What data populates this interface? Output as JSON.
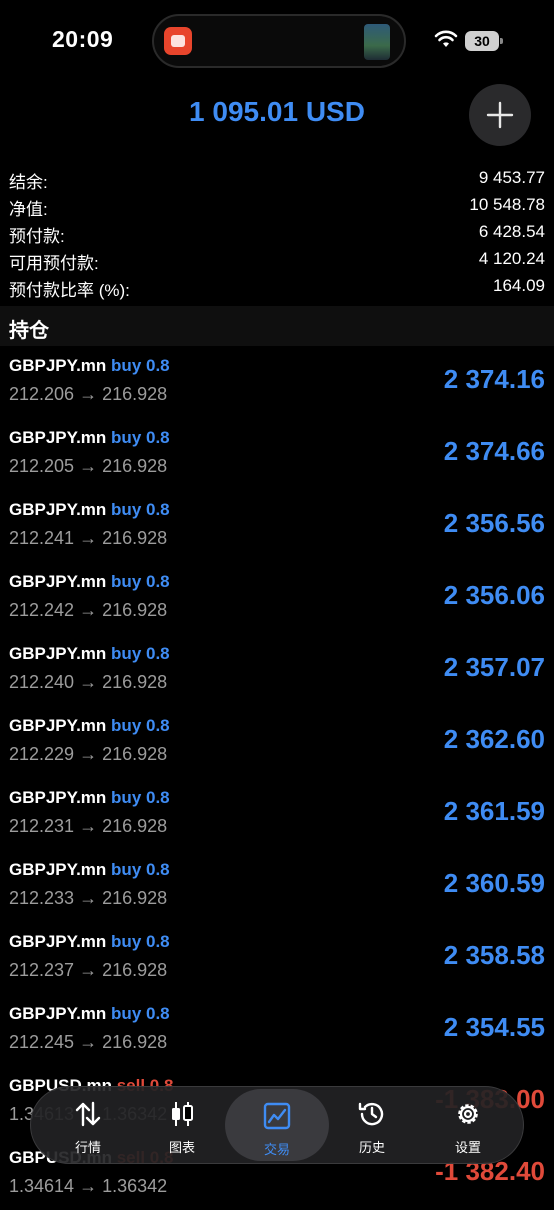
{
  "status_bar": {
    "time": "20:09",
    "battery": "30"
  },
  "header": {
    "balance": "1 095.01 USD"
  },
  "summary": [
    {
      "label": "结余:",
      "value": "9 453.77"
    },
    {
      "label": "净值:",
      "value": "10 548.78"
    },
    {
      "label": "预付款:",
      "value": "6 428.54"
    },
    {
      "label": "可用预付款:",
      "value": "4 120.24"
    },
    {
      "label": "预付款比率 (%):",
      "value": "164.09"
    }
  ],
  "section_title": "持仓",
  "positions": [
    {
      "symbol": "GBPJPY.mn",
      "side": "buy 0.8",
      "prices": "212.206 → 216.928",
      "profit": "2 374.16"
    },
    {
      "symbol": "GBPJPY.mn",
      "side": "buy 0.8",
      "prices": "212.205 → 216.928",
      "profit": "2 374.66"
    },
    {
      "symbol": "GBPJPY.mn",
      "side": "buy 0.8",
      "prices": "212.241 → 216.928",
      "profit": "2 356.56"
    },
    {
      "symbol": "GBPJPY.mn",
      "side": "buy 0.8",
      "prices": "212.242 → 216.928",
      "profit": "2 356.06"
    },
    {
      "symbol": "GBPJPY.mn",
      "side": "buy 0.8",
      "prices": "212.240 → 216.928",
      "profit": "2 357.07"
    },
    {
      "symbol": "GBPJPY.mn",
      "side": "buy 0.8",
      "prices": "212.229 → 216.928",
      "profit": "2 362.60"
    },
    {
      "symbol": "GBPJPY.mn",
      "side": "buy 0.8",
      "prices": "212.231 → 216.928",
      "profit": "2 361.59"
    },
    {
      "symbol": "GBPJPY.mn",
      "side": "buy 0.8",
      "prices": "212.233 → 216.928",
      "profit": "2 360.59"
    },
    {
      "symbol": "GBPJPY.mn",
      "side": "buy 0.8",
      "prices": "212.237 → 216.928",
      "profit": "2 358.58"
    },
    {
      "symbol": "GBPJPY.mn",
      "side": "buy 0.8",
      "prices": "212.245 → 216.928",
      "profit": "2 354.55"
    },
    {
      "symbol": "GBPUSD.mn",
      "side": "sell 0.8",
      "prices": "1.34613 → 1.36342",
      "profit": "-1 383.00"
    },
    {
      "symbol": "GBPUSD.mn",
      "side": "sell 0.8",
      "prices": "1.34614 → 1.36342",
      "profit": "-1 382.40"
    }
  ],
  "tabs": [
    {
      "label": "行情",
      "icon": "quotes-arrows-icon"
    },
    {
      "label": "图表",
      "icon": "candlestick-icon"
    },
    {
      "label": "交易",
      "icon": "trade-chart-icon",
      "active": true
    },
    {
      "label": "历史",
      "icon": "history-clock-icon"
    },
    {
      "label": "设置",
      "icon": "gear-icon"
    }
  ],
  "colors": {
    "accent": "#3f8cf3",
    "loss": "#e04a3a",
    "background": "#000000"
  }
}
